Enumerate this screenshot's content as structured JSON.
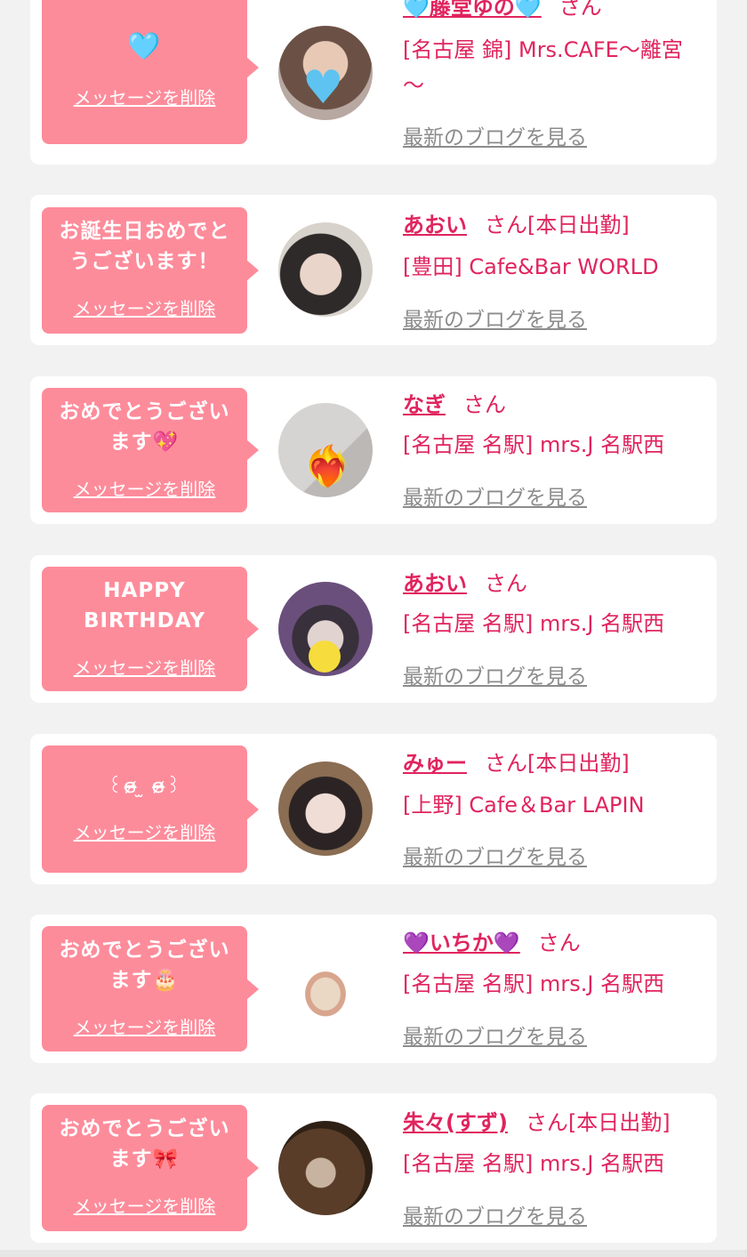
{
  "colors": {
    "background": "#f2f2f2",
    "card": "#ffffff",
    "bubble": "#fd8c9b",
    "accent_pink": "#e0245e",
    "link_gray": "#8c8c8c"
  },
  "messages": [
    {
      "message": "🩵",
      "delete_label": "メッセージを削除",
      "name": "🩵藤堂ゆの🩵",
      "honorific": "さん",
      "badge": "",
      "shop": "[名古屋 錦] Mrs.CAFE～離宮～",
      "blog_label": "最新のブログを見る",
      "avatar_icon": "avatar-photo-heart-sticker"
    },
    {
      "message": "お誕生日おめでとうございます！",
      "delete_label": "メッセージを削除",
      "name": "あおい",
      "honorific": "さん",
      "badge": "[本日出勤]",
      "shop": "[豊田] Cafe&Bar WORLD",
      "blog_label": "最新のブログを見る",
      "avatar_icon": "avatar-photo"
    },
    {
      "message": "おめでとうございます💖",
      "delete_label": "メッセージを削除",
      "name": "なぎ",
      "honorific": "さん",
      "badge": "",
      "shop": "[名古屋 名駅] mrs.J 名駅西",
      "blog_label": "最新のブログを見る",
      "avatar_icon": "avatar-photo-fire-heart-sticker"
    },
    {
      "message": "HAPPY BIRTHDAY",
      "delete_label": "メッセージを削除",
      "name": "あおい",
      "honorific": "さん",
      "badge": "",
      "shop": "[名古屋 名駅] mrs.J 名駅西",
      "blog_label": "最新のブログを見る",
      "avatar_icon": "avatar-photo-yellow-sticker"
    },
    {
      "message": "꒰ɞ̴̶̷ ̫ ɞ̴̶̷꒱",
      "delete_label": "メッセージを削除",
      "name": "みゅー",
      "honorific": "さん",
      "badge": "[本日出勤]",
      "shop": "[上野] Cafe＆Bar LAPIN",
      "blog_label": "最新のブログを見る",
      "avatar_icon": "avatar-photo"
    },
    {
      "message": "おめでとうございます🎂",
      "delete_label": "メッセージを削除",
      "name": "💜いちか💜",
      "honorific": "さん",
      "badge": "",
      "shop": "[名古屋 名駅] mrs.J 名駅西",
      "blog_label": "最新のブログを見る",
      "avatar_icon": "avatar-photo"
    },
    {
      "message": "おめでとうございます🎀",
      "delete_label": "メッセージを削除",
      "name": "朱々(すず)",
      "honorific": "さん",
      "badge": "[本日出勤]",
      "shop": "[名古屋 名駅] mrs.J 名駅西",
      "blog_label": "最新のブログを見る",
      "avatar_icon": "avatar-photo"
    }
  ]
}
